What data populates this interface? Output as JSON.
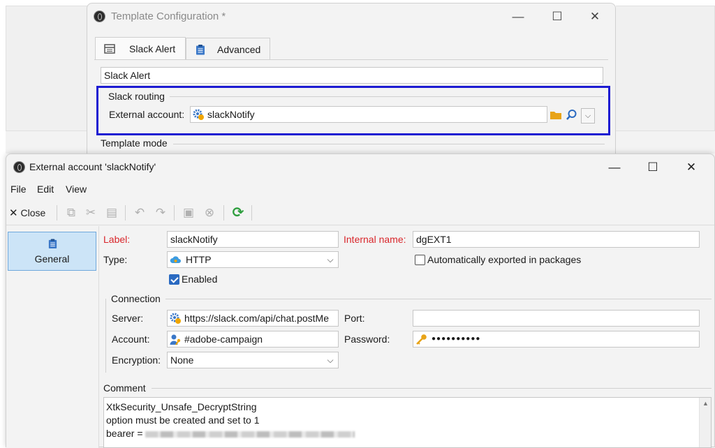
{
  "back_window": {
    "title": "Template Configuration *",
    "tabs": [
      {
        "label": "Slack Alert",
        "icon": "form-icon"
      },
      {
        "label": "Advanced",
        "icon": "clipboard-icon"
      }
    ],
    "name_value": "Slack Alert",
    "routing": {
      "title": "Slack routing",
      "external_account_label": "External account:",
      "external_account_value": "slackNotify"
    },
    "template_mode_label": "Template mode"
  },
  "front_window": {
    "title": "External account 'slackNotify'",
    "menu": [
      "File",
      "Edit",
      "View"
    ],
    "toolbar": {
      "close_label": "Close"
    },
    "sidebar": {
      "items": [
        {
          "label": "General",
          "icon": "clipboard-icon"
        }
      ]
    },
    "form": {
      "label_label": "Label:",
      "label_value": "slackNotify",
      "internal_name_label": "Internal name:",
      "internal_name_value": "dgEXT1",
      "type_label": "Type:",
      "type_value": "HTTP",
      "auto_export_label": "Automatically exported in packages",
      "auto_export_checked": false,
      "enabled_label": "Enabled",
      "enabled_checked": true,
      "connection": {
        "title": "Connection",
        "server_label": "Server:",
        "server_value": "https://slack.com/api/chat.postMe",
        "port_label": "Port:",
        "port_value": "",
        "account_label": "Account:",
        "account_value": "#adobe-campaign",
        "password_label": "Password:",
        "password_value": "●●●●●●●●●●",
        "encryption_label": "Encryption:",
        "encryption_value": "None"
      },
      "comment": {
        "title": "Comment",
        "line1": "XtkSecurity_Unsafe_DecryptString",
        "line2": "option must be created and set to 1",
        "line3": "bearer ="
      }
    }
  },
  "colors": {
    "highlight": "#1d1bd2",
    "required_label": "#d9262b",
    "selected_item": "#cce4f7",
    "checkbox": "#2a6ac1"
  }
}
